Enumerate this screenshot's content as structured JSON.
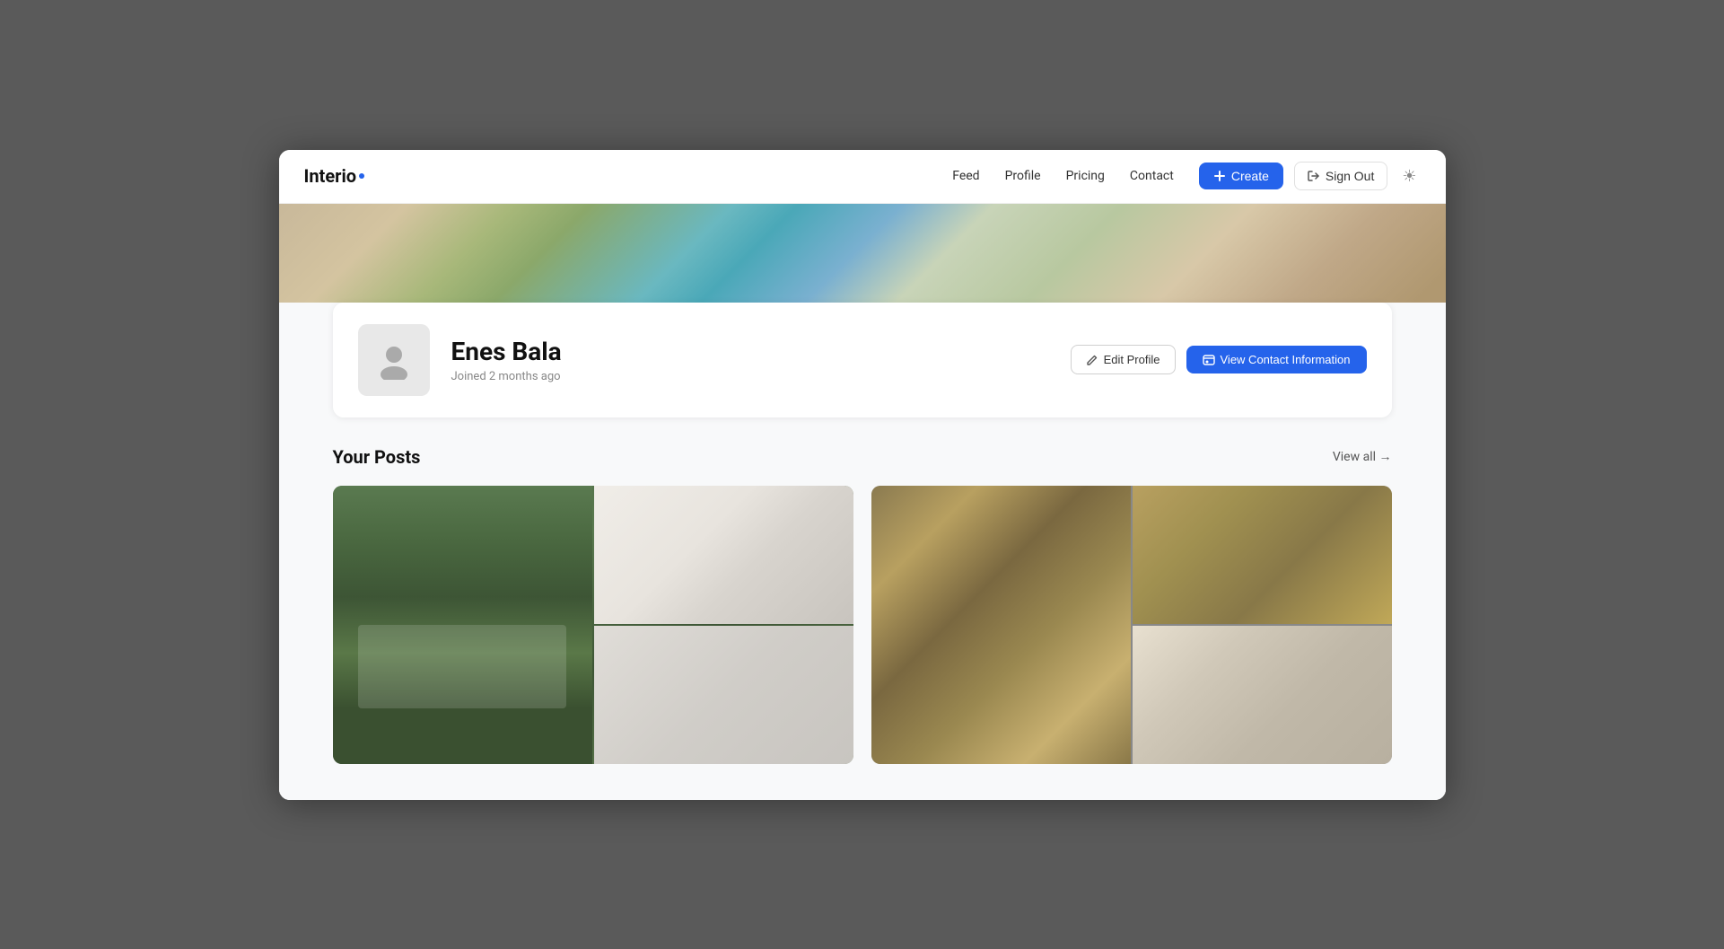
{
  "app": {
    "name": "Interio"
  },
  "navbar": {
    "logo": "Interio",
    "links": [
      {
        "id": "feed",
        "label": "Feed"
      },
      {
        "id": "profile",
        "label": "Profile"
      },
      {
        "id": "pricing",
        "label": "Pricing"
      },
      {
        "id": "contact",
        "label": "Contact"
      }
    ],
    "create_button": "Create",
    "sign_out_button": "Sign Out",
    "theme_icon": "☀"
  },
  "profile": {
    "name": "Enes Bala",
    "joined": "Joined 2 months ago",
    "edit_profile_label": "Edit Profile",
    "view_contact_label": "View Contact Information"
  },
  "posts": {
    "section_title": "Your Posts",
    "view_all_label": "View all →"
  }
}
